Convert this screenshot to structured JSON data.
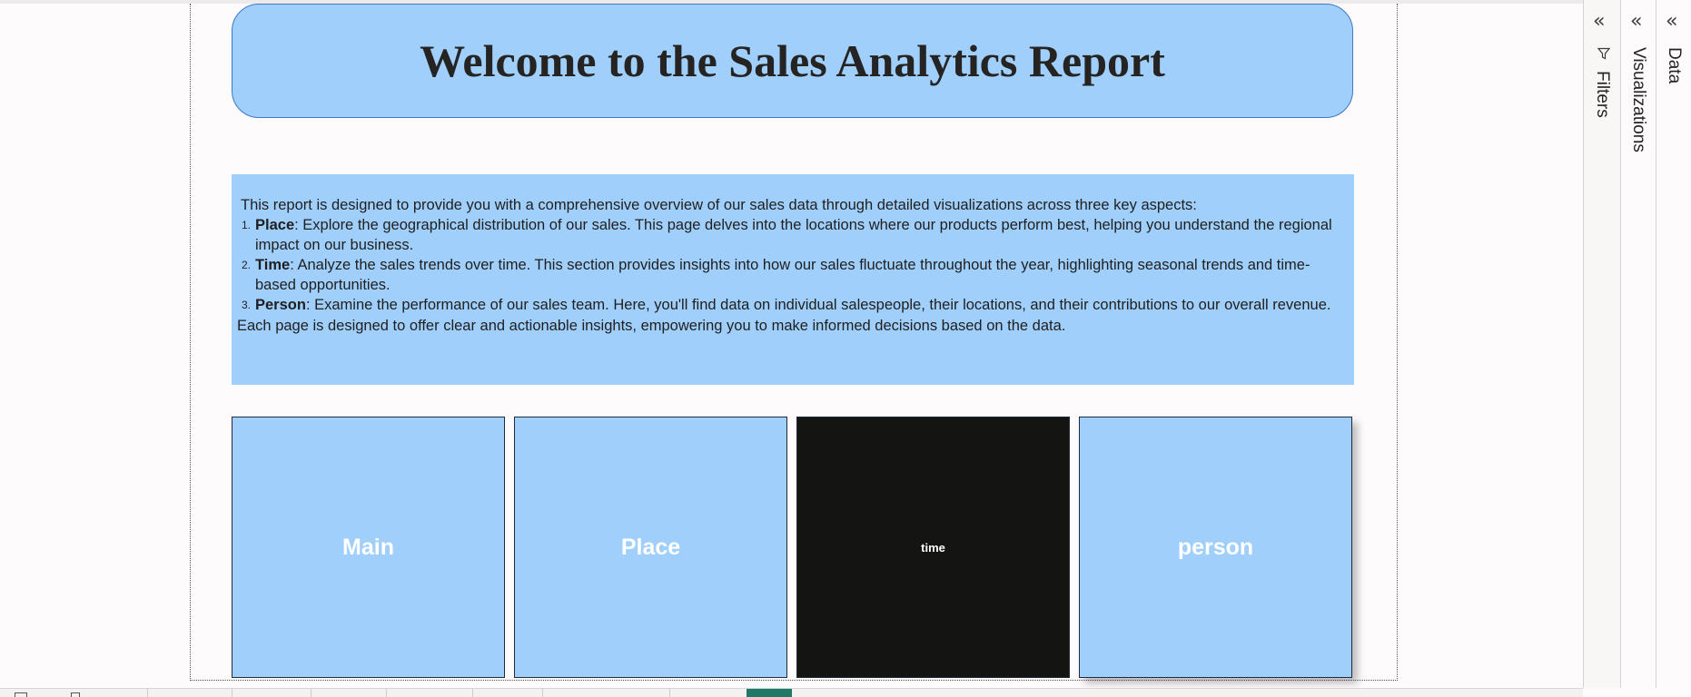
{
  "report": {
    "title": "Welcome to the Sales Analytics Report",
    "intro": "This report is designed to provide you with a comprehensive overview of our sales data through detailed visualizations across three key aspects:",
    "items": [
      {
        "num": "1.",
        "label": "Place",
        "text": ": Explore the geographical distribution of our sales. This page delves into the locations where our products perform best, helping you understand the regional impact on our business."
      },
      {
        "num": "2.",
        "label": "Time",
        "text": ": Analyze the sales trends over time. This section provides insights into how our sales fluctuate throughout the year, highlighting seasonal trends and time-based opportunities."
      },
      {
        "num": "3.",
        "label": "Person",
        "text": ": Examine the performance of our sales team. Here, you'll find data on individual salespeople, their locations, and their contributions to our overall revenue."
      }
    ],
    "outro": "Each page is designed to offer clear and actionable insights, empowering you to make informed decisions based on the data."
  },
  "nav_buttons": {
    "main": "Main",
    "place": "Place",
    "time": "time",
    "person": "person"
  },
  "panes": {
    "filters": "Filters",
    "visualizations": "Visualizations",
    "data": "Data",
    "collapse_icon": "double-chevron-left-icon",
    "filter_icon": "funnel-icon"
  },
  "colors": {
    "tile_light": "#a0cffc",
    "tile_dark": "#141412",
    "active_tab": "#1e7a66"
  }
}
